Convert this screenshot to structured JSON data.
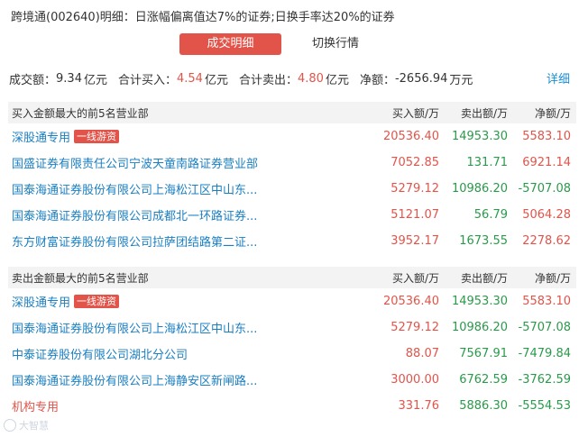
{
  "header": {
    "title": "跨境通(002640)明细：日涨幅偏离值达7%的证券;日换手率达20%的证券"
  },
  "tabs": [
    {
      "label": "成交明细",
      "active": true
    },
    {
      "label": "切换行情",
      "active": false
    }
  ],
  "summary": {
    "turnover_label": "成交额：",
    "turnover_value": "9.34",
    "turnover_unit": "亿元",
    "buy_label": "合计买入：",
    "buy_value": "4.54",
    "buy_unit": "亿元",
    "sell_label": "合计卖出：",
    "sell_value": "4.80",
    "sell_unit": "亿元",
    "net_label": "净额：",
    "net_value": "-2656.94",
    "net_unit": "万元",
    "detail_link": "详细"
  },
  "buy_section": {
    "heading": "买入金额最大的前5名营业部",
    "col_buy": "买入额/万",
    "col_sell": "卖出额/万",
    "col_net": "净额/万",
    "rows": [
      {
        "name": "深股通专用",
        "tag": "一线游资",
        "buy": "20536.40",
        "sell": "14953.30",
        "net": "5583.10"
      },
      {
        "name": "国盛证券有限责任公司宁波天童南路证券营业部",
        "tag": "",
        "buy": "7052.85",
        "sell": "131.71",
        "net": "6921.14"
      },
      {
        "name": "国泰海通证券股份有限公司上海松江区中山东...",
        "tag": "",
        "buy": "5279.12",
        "sell": "10986.20",
        "net": "-5707.08"
      },
      {
        "name": "国泰海通证券股份有限公司成都北一环路证券...",
        "tag": "",
        "buy": "5121.07",
        "sell": "56.79",
        "net": "5064.28"
      },
      {
        "name": "东方财富证券股份有限公司拉萨团结路第二证...",
        "tag": "",
        "buy": "3952.17",
        "sell": "1673.55",
        "net": "2278.62"
      }
    ]
  },
  "sell_section": {
    "heading": "卖出金额最大的前5名营业部",
    "col_buy": "买入额/万",
    "col_sell": "卖出额/万",
    "col_net": "净额/万",
    "rows": [
      {
        "name": "深股通专用",
        "tag": "一线游资",
        "buy": "20536.40",
        "sell": "14953.30",
        "net": "5583.10"
      },
      {
        "name": "国泰海通证券股份有限公司上海松江区中山东...",
        "tag": "",
        "buy": "5279.12",
        "sell": "10986.20",
        "net": "-5707.08"
      },
      {
        "name": "中泰证券股份有限公司湖北分公司",
        "tag": "",
        "buy": "88.07",
        "sell": "7567.91",
        "net": "-7479.84"
      },
      {
        "name": "国泰海通证券股份有限公司上海静安区新闸路...",
        "tag": "",
        "buy": "3000.00",
        "sell": "6762.59",
        "net": "-3762.59"
      },
      {
        "name": "机构专用",
        "tag": "",
        "buy": "331.76",
        "sell": "5886.30",
        "net": "-5554.53"
      }
    ]
  },
  "colors": {
    "accent_red": "#e2544a",
    "link_blue": "#1a7fc2",
    "negative_green": "#2a9a4a"
  },
  "watermark": {
    "text": "大智慧"
  }
}
